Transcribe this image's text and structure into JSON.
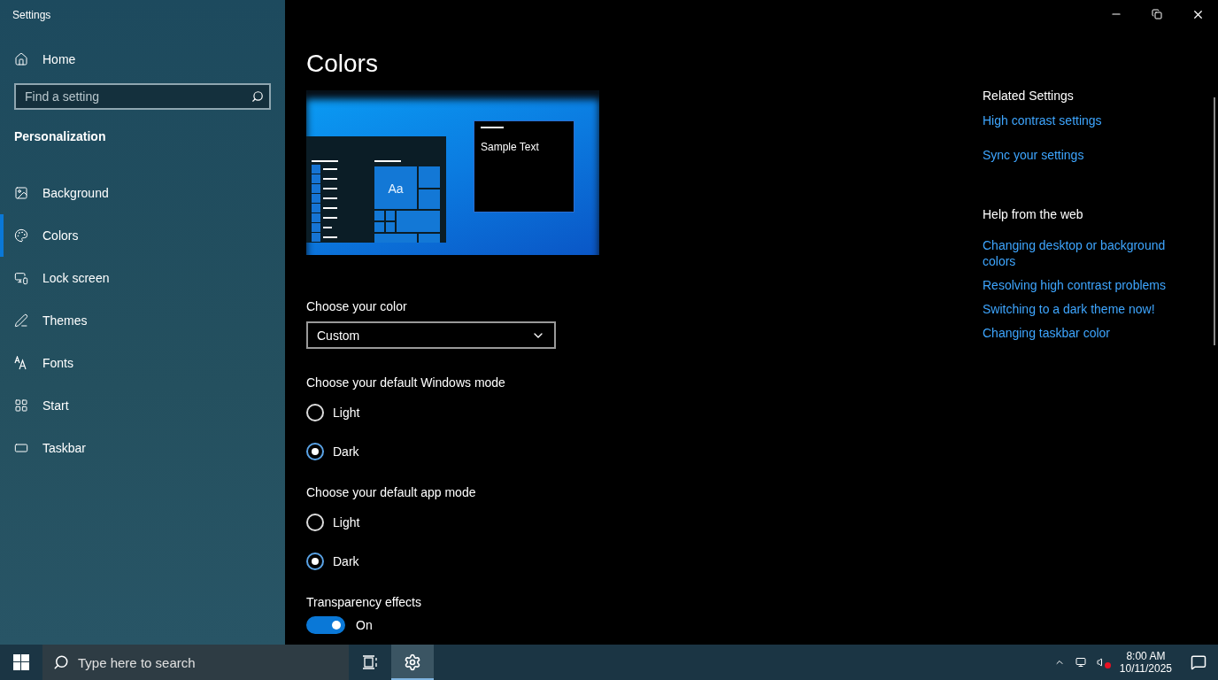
{
  "window": {
    "title": "Settings"
  },
  "sidebar": {
    "home": "Home",
    "search": {
      "placeholder": "Find a setting"
    },
    "section": "Personalization",
    "items": [
      {
        "label": "Background",
        "selected": false
      },
      {
        "label": "Colors",
        "selected": true
      },
      {
        "label": "Lock screen",
        "selected": false
      },
      {
        "label": "Themes",
        "selected": false
      },
      {
        "label": "Fonts",
        "selected": false
      },
      {
        "label": "Start",
        "selected": false
      },
      {
        "label": "Taskbar",
        "selected": false
      }
    ]
  },
  "main": {
    "title": "Colors",
    "preview": {
      "tile_text": "Aa",
      "sample_text": "Sample Text"
    },
    "color_choice": {
      "label": "Choose your color",
      "value": "Custom"
    },
    "windows_mode": {
      "label": "Choose your default Windows mode",
      "options": [
        {
          "label": "Light",
          "selected": false
        },
        {
          "label": "Dark",
          "selected": true
        }
      ]
    },
    "app_mode": {
      "label": "Choose your default app mode",
      "options": [
        {
          "label": "Light",
          "selected": false
        },
        {
          "label": "Dark",
          "selected": true
        }
      ]
    },
    "transparency": {
      "label": "Transparency effects",
      "on": true,
      "state_text": "On"
    }
  },
  "related": {
    "heading": "Related Settings",
    "links": [
      "High contrast settings",
      "Sync your settings"
    ]
  },
  "help": {
    "heading": "Help from the web",
    "links": [
      "Changing desktop or background colors",
      "Resolving high contrast problems",
      "Switching to a dark theme now!",
      "Changing taskbar color"
    ]
  },
  "taskbar": {
    "search": {
      "placeholder": "Type here to search"
    },
    "time": "8:00 AM",
    "date": "10/11/2025",
    "settings_active": true
  }
}
